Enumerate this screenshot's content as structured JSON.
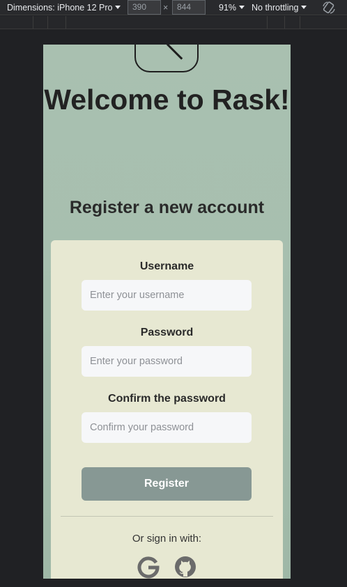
{
  "devtools": {
    "dimensions_label": "Dimensions: iPhone 12 Pro",
    "width": "390",
    "times": "×",
    "height": "844",
    "zoom": "91%",
    "throttling": "No throttling"
  },
  "page": {
    "welcome_title": "Welcome to Rask!",
    "register_heading": "Register a new account",
    "form": {
      "username_label": "Username",
      "username_placeholder": "Enter your username",
      "password_label": "Password",
      "password_placeholder": "Enter your password",
      "confirm_label": "Confirm the password",
      "confirm_placeholder": "Confirm your password",
      "register_button": "Register"
    },
    "social": {
      "or_text": "Or sign in with:",
      "providers": [
        "google-icon",
        "github-icon"
      ]
    }
  },
  "colors": {
    "background": "#a9c0b0",
    "card": "#e7e8d2",
    "button": "#879894",
    "text": "#222222"
  }
}
